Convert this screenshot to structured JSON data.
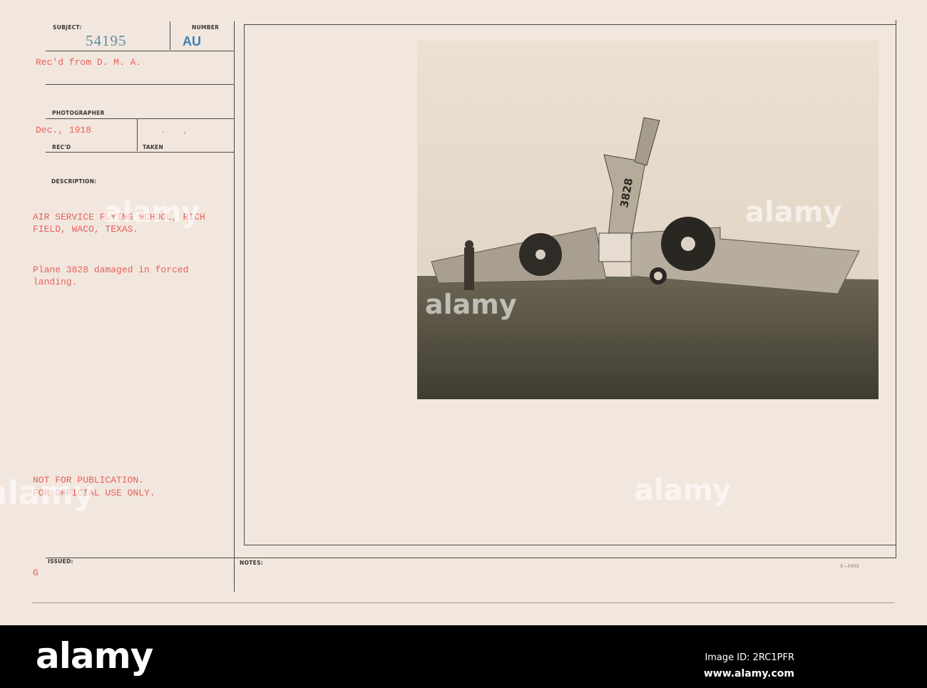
{
  "card": {
    "subject_label": "SUBJECT:",
    "subject_number": "54195",
    "number_label": "NUMBER",
    "number_stamp": "AU",
    "received_from": "Rec'd from D. M. A.",
    "photographer_label": "PHOTOGRAPHER",
    "received_date": "Dec., 1918",
    "taken_date": ".   ,",
    "recd_label": "REC'D",
    "taken_label": "TAKEN",
    "description_label": "DESCRIPTION:",
    "description_lines": [
      "AIR SERVICE FLYING SCHOOL, RICH",
      "FIELD, WACO, TEXAS.",
      "Plane 3828 damaged in forced",
      "landing."
    ],
    "restriction_lines": [
      "NOT FOR PUBLICATION.",
      "FOR OFFICIAL USE ONLY."
    ],
    "issued_label": "ISSUED:",
    "issued_value": "G",
    "notes_label": "NOTES:",
    "form_number": "3—5005"
  },
  "photo": {
    "fuselage_number": "3828"
  },
  "watermark": "alamy",
  "footer": {
    "logo": "alamy",
    "image_id": "Image ID: 2RC1PFR",
    "url": "www.alamy.com"
  }
}
